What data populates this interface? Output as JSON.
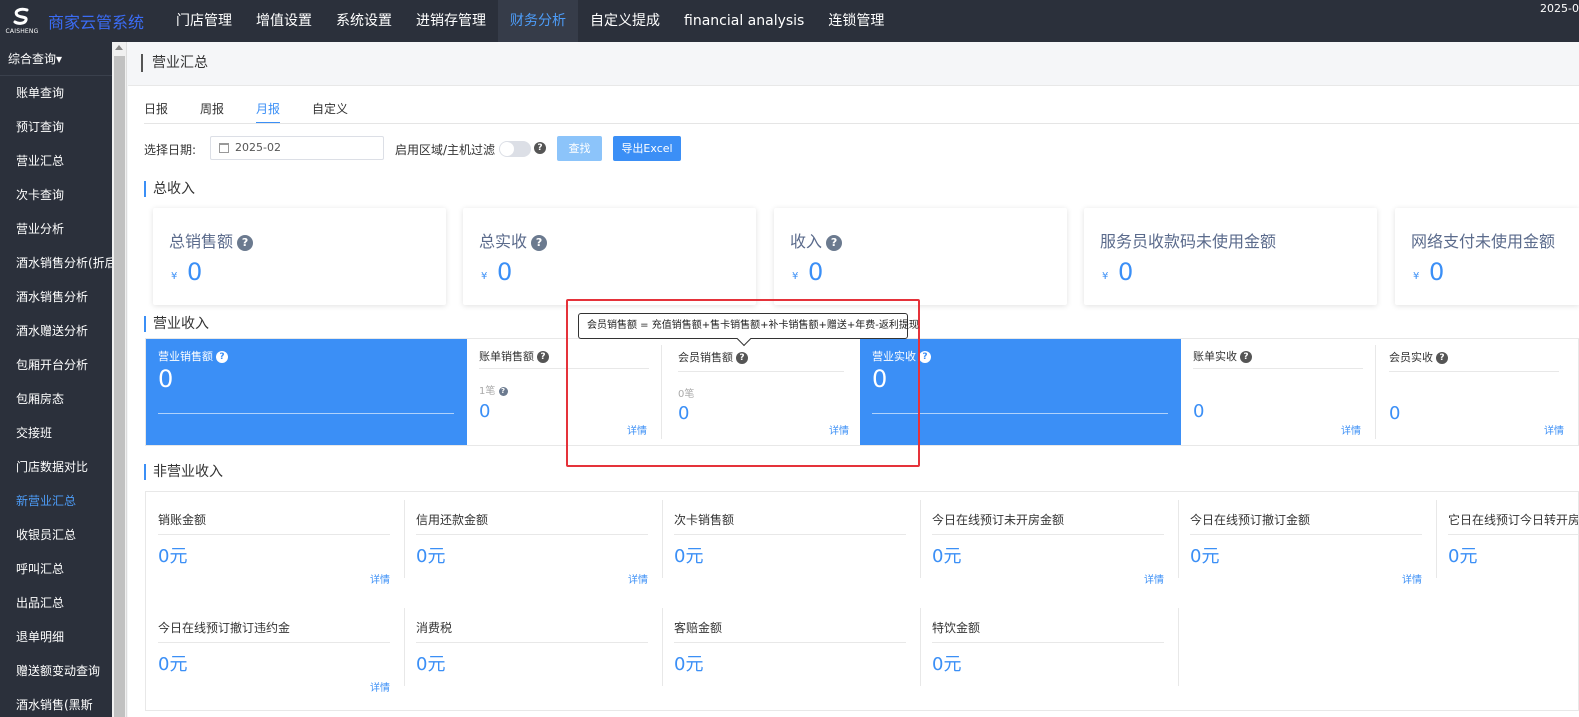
{
  "app": {
    "logo_text": "CAISHENG",
    "brand": "商家云管系统",
    "date": "2025-0"
  },
  "topnav": [
    "门店管理",
    "增值设置",
    "系统设置",
    "进销存管理",
    "财务分析",
    "自定义提成",
    "financial analysis",
    "连锁管理"
  ],
  "sidebar": {
    "header": "综合查询▾",
    "items": [
      "账单查询",
      "预订查询",
      "营业汇总",
      "次卡查询",
      "营业分析",
      "酒水销售分析(折后)",
      "酒水销售分析",
      "酒水赠送分析",
      "包厢开台分析",
      "包厢房态",
      "交接班",
      "门店数据对比",
      "新营业汇总",
      "收银员汇总",
      "呼叫汇总",
      "出品汇总",
      "退单明细",
      "赠送额变动查询",
      "酒水销售(黑斯"
    ]
  },
  "page": {
    "title": "营业汇总",
    "tabs": [
      "日报",
      "周报",
      "月报",
      "自定义"
    ],
    "date_label": "选择日期:",
    "date_value": "2025-02",
    "region_label": "启用区域/主机过滤",
    "search_button": "查找",
    "export_button": "导出Excel"
  },
  "total_income": {
    "title": "总收入",
    "cards": [
      {
        "label": "总销售额",
        "currency": "¥",
        "value": "0"
      },
      {
        "label": "总实收",
        "currency": "¥",
        "value": "0"
      },
      {
        "label": "收入",
        "currency": "¥",
        "value": "0"
      },
      {
        "label": "服务员收款码未使用金额",
        "currency": "¥",
        "value": "0"
      },
      {
        "label": "网络支付未使用金额",
        "currency": "¥",
        "value": "0"
      }
    ]
  },
  "business_income": {
    "title": "营业收入",
    "cards": [
      {
        "label": "营业销售额",
        "value": "0"
      },
      {
        "label": "账单销售额",
        "sub": "1笔",
        "value": "0",
        "detail": "详情"
      },
      {
        "label": "会员销售额",
        "sub": "0笔",
        "value": "0",
        "detail": "详情"
      },
      {
        "label": "营业实收",
        "value": "0"
      },
      {
        "label": "账单实收",
        "value": "0",
        "detail": "详情"
      },
      {
        "label": "会员实收",
        "value": "0",
        "detail": "详情"
      }
    ],
    "tooltip": "会员销售额 = 充值销售额+售卡销售额+补卡销售额+赠送+年费-返利提现"
  },
  "non_business_income": {
    "title": "非营业收入",
    "cards": [
      {
        "label": "销账金额",
        "value": "0元",
        "detail": "详情"
      },
      {
        "label": "信用还款金额",
        "value": "0元",
        "detail": "详情"
      },
      {
        "label": "次卡销售额",
        "value": "0元"
      },
      {
        "label": "今日在线预订未开房金额",
        "value": "0元",
        "detail": "详情"
      },
      {
        "label": "今日在线预订撤订金额",
        "value": "0元",
        "detail": "详情"
      },
      {
        "label": "它日在线预订今日转开房",
        "value": "0元"
      },
      {
        "label": "今日在线预订撤订违约金",
        "value": "0元",
        "detail": "详情"
      },
      {
        "label": "消费税",
        "value": "0元"
      },
      {
        "label": "客赔金额",
        "value": "0元"
      },
      {
        "label": "特饮金额",
        "value": "0元"
      }
    ]
  },
  "colors": {
    "accent": "#3b8ff6",
    "nav_bg": "#2b303b",
    "highlight": "#e5323a"
  }
}
